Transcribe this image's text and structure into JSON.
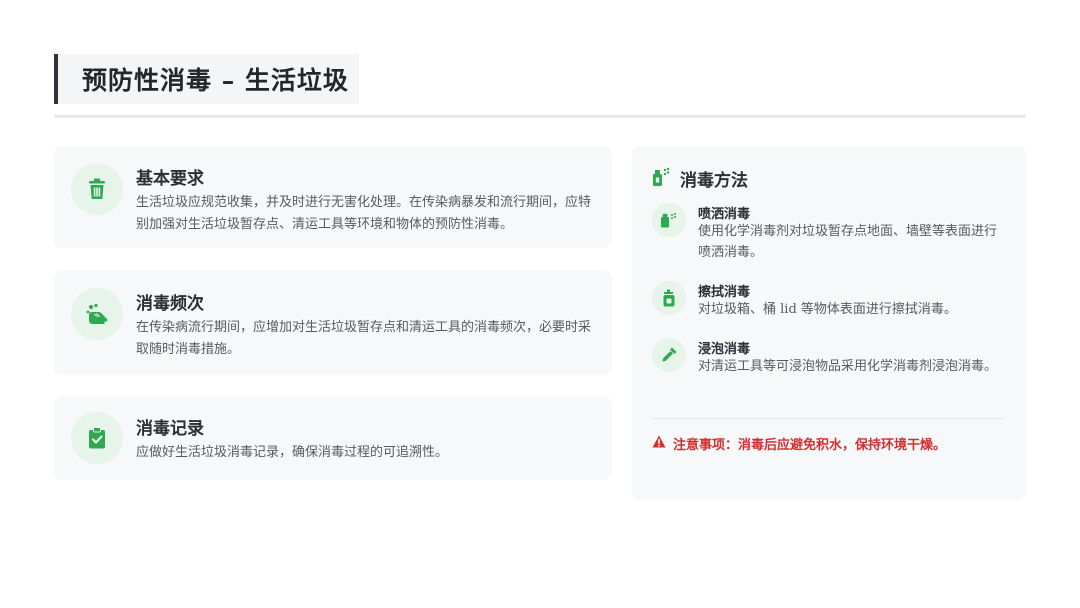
{
  "header": {
    "title": "预防性消毒 – 生活垃圾"
  },
  "cards": [
    {
      "icon": "trash-icon",
      "title": "基本要求",
      "body": "生活垃圾应规范收集，并及时进行无害化处理。在传染病暴发和流行期间，应特别加强对生活垃圾暂存点、清运工具等环境和物体的预防性消毒。"
    },
    {
      "icon": "hands-wash-icon",
      "title": "消毒频次",
      "body": "在传染病流行期间，应增加对生活垃圾暂存点和清运工具的消毒频次，必要时采取随时消毒措施。"
    },
    {
      "icon": "clipboard-check-icon",
      "title": "消毒记录",
      "body": "应做好生活垃圾消毒记录，确保消毒过程的可追溯性。"
    }
  ],
  "methods_panel": {
    "icon": "spray-bottle-icon",
    "title": "消毒方法",
    "methods": [
      {
        "icon": "spray-can-icon",
        "title": "喷洒消毒",
        "body": "使用化学消毒剂对垃圾暂存点地面、墙壁等表面进行喷洒消毒。"
      },
      {
        "icon": "pump-bottle-icon",
        "title": "擦拭消毒",
        "body": "对垃圾箱、桶 lid 等物体表面进行擦拭消毒。"
      },
      {
        "icon": "eyedropper-icon",
        "title": "浸泡消毒",
        "body": "对清运工具等可浸泡物品采用化学消毒剂浸泡消毒。"
      }
    ],
    "notice": {
      "icon": "warning-icon",
      "text": "注意事项：消毒后应避免积水，保持环境干燥。"
    }
  },
  "colors": {
    "accent_green": "#2fa84f",
    "icon_bg": "#e6f4ea",
    "warning_red": "#d32f2f",
    "title_bar": "#2f3337"
  }
}
